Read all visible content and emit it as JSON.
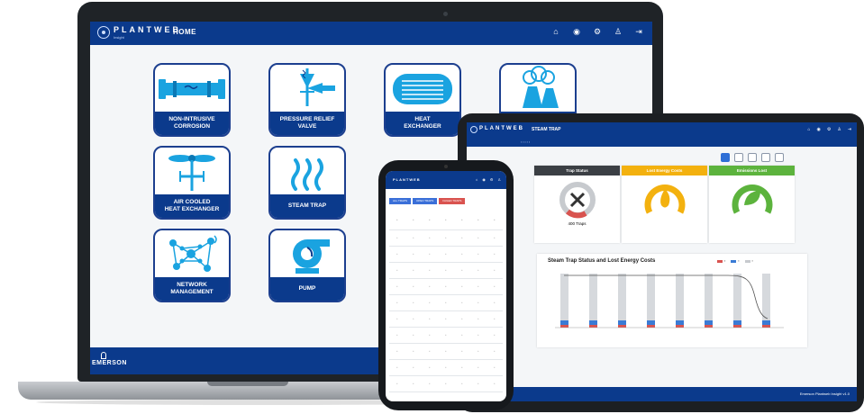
{
  "laptop": {
    "header": {
      "brand": "PLANTWEB",
      "sub": "Insight",
      "page_title": "HOME"
    },
    "header_icons": [
      "home-icon",
      "globe-icon",
      "settings-icon",
      "user-icon",
      "logout-icon"
    ],
    "tiles": [
      {
        "label": "NON-INTRUSIVE\nCORROSION",
        "icon": "pipe-icon"
      },
      {
        "label": "PRESSURE RELIEF\nVALVE",
        "icon": "relief-valve-icon"
      },
      {
        "label": "HEAT\nEXCHANGER",
        "icon": "heat-exchanger-icon"
      },
      {
        "label": "",
        "icon": "cooling-tower-icon"
      },
      {
        "label": "AIR COOLED\nHEAT EXCHANGER",
        "icon": "fan-icon"
      },
      {
        "label": "STEAM TRAP",
        "icon": "steam-icon"
      },
      {
        "label": "NETWORK\nMANAGEMENT",
        "icon": "network-icon"
      },
      {
        "label": "PUMP",
        "icon": "pump-icon"
      }
    ],
    "footer": {
      "brand": "EMERSON"
    }
  },
  "tablet": {
    "header": {
      "brand": "PLANTWEB",
      "page_title": "STEAM TRAP"
    },
    "cards": [
      {
        "title": "Trap Status",
        "value": "400 Traps",
        "color": "#3b3f44"
      },
      {
        "title": "Lost Energy Costs",
        "value": "",
        "color": "#f3b10f"
      },
      {
        "title": "Emissions Lost",
        "value": "",
        "color": "#5cb33d"
      }
    ],
    "chart_title": "Steam Trap Status and Lost Energy Costs",
    "footer_text": "Emerson Plantweb Insight v1.0"
  },
  "phone": {
    "header": {
      "brand": "PLANTWEB"
    },
    "tabs": [
      "ALL TRAPS",
      "OPEN TRAPS",
      "FAILED TRAPS"
    ]
  },
  "colors": {
    "brand_blue": "#0b3a8c",
    "tile_blue": "#1aa3e0",
    "accent_yellow": "#f3b10f",
    "accent_green": "#5cb33d"
  }
}
